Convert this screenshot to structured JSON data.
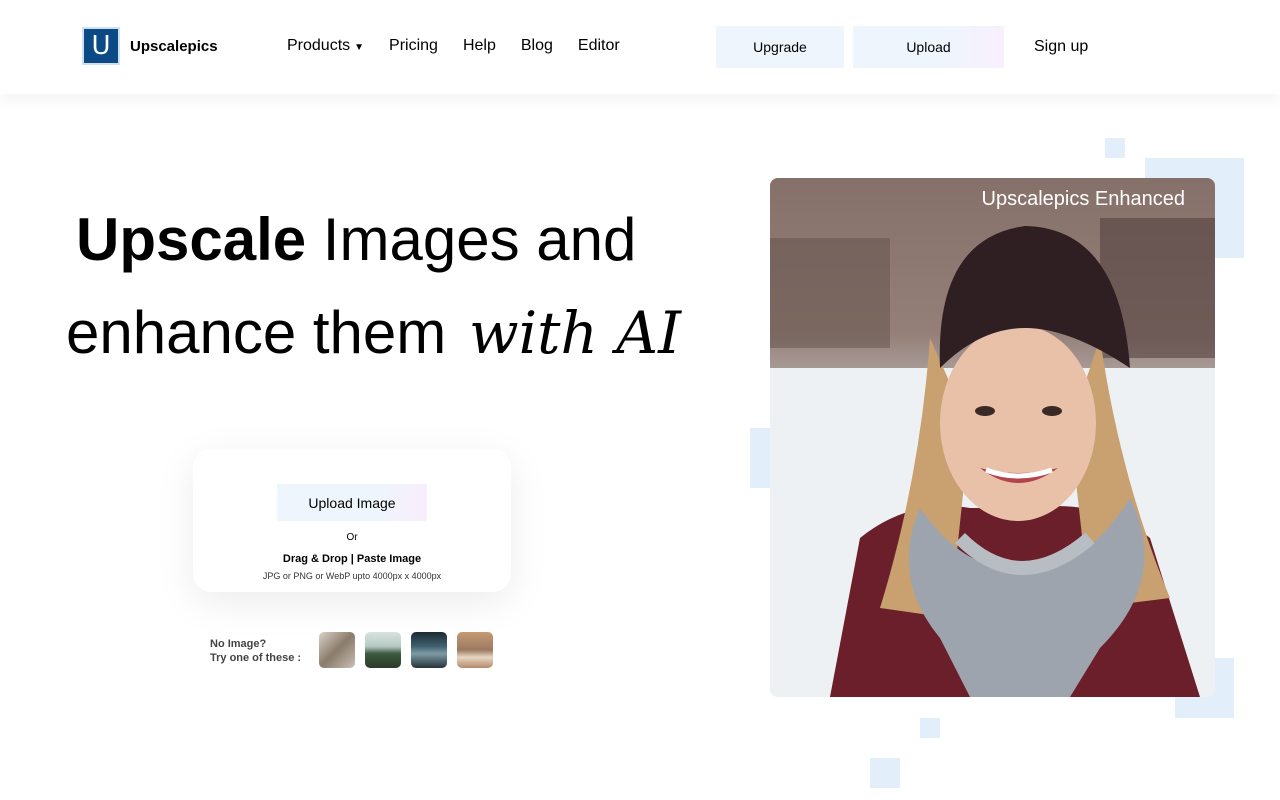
{
  "brand": {
    "logo_letter": "U",
    "name": "Upscalepics"
  },
  "nav": {
    "items": [
      {
        "label": "Products",
        "has_dropdown": true
      },
      {
        "label": "Pricing"
      },
      {
        "label": "Help"
      },
      {
        "label": "Blog"
      },
      {
        "label": "Editor"
      }
    ],
    "caret": "▼"
  },
  "header_actions": {
    "upgrade": "Upgrade",
    "upload": "Upload",
    "signup": "Sign up"
  },
  "hero": {
    "bold_word": "Upscale",
    "line1_rest": " Images and",
    "line2": "enhance them",
    "line2_ai": "with AI"
  },
  "upload_card": {
    "button": "Upload Image",
    "or": "Or",
    "drag": "Drag & Drop | Paste Image",
    "formats": "JPG or PNG or WebP upto 4000px x 4000px"
  },
  "samples": {
    "prompt_line1": "No Image?",
    "prompt_line2": "Try one of these :",
    "thumbnails": [
      "cat-photo",
      "lake-forest-photo",
      "canal-city-photo",
      "desk-laptop-photo"
    ]
  },
  "preview": {
    "label": "Upscalepics Enhanced",
    "subject": "woman-in-beanie-photo"
  },
  "colors": {
    "accent_light": "#e3eefb",
    "logo_bg": "#0c4a86"
  }
}
